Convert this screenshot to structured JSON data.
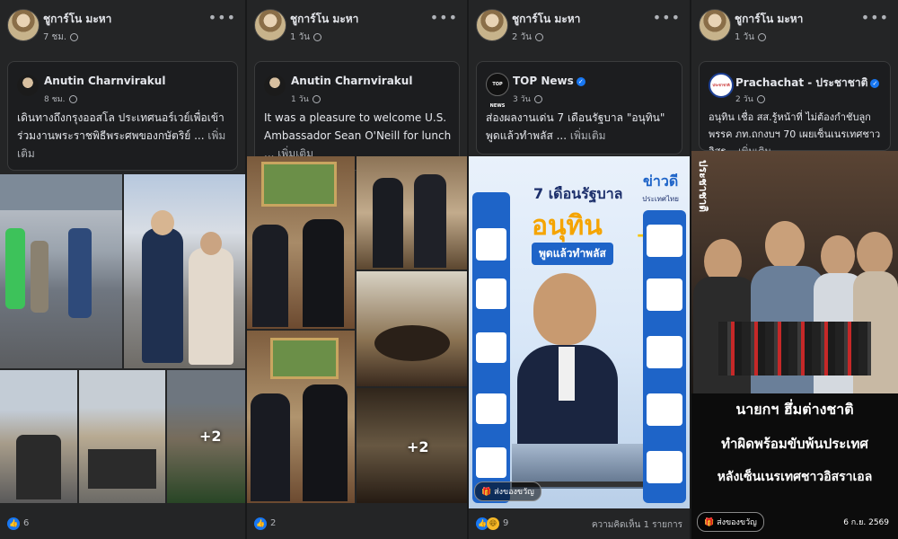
{
  "posts": [
    {
      "poster": "ชูการ์โน มะหา",
      "time": "7 ชม.",
      "card": {
        "name": "Anutin Charnvirakul",
        "time": "8 ชม.",
        "text": "เดินทางถึงกรุงออสโล ประเทศนอร์เวย์เพื่อเข้าร่วมงานพระราชพิธีพระศพของกษัตริย์ ...",
        "see_more": "เพิ่มเติม"
      },
      "photo_more": "+2",
      "reactions": "6"
    },
    {
      "poster": "ชูการ์โน มะหา",
      "time": "1 วัน",
      "card": {
        "name": "Anutin Charnvirakul",
        "time": "1 วัน",
        "text": "It was a pleasure to welcome U.S. Ambassador Sean O'Neill for lunch ...",
        "see_more": "เพิ่มเติม"
      },
      "photo_more": "+2",
      "reactions": "2"
    },
    {
      "poster": "ชูการ์โน มะหา",
      "time": "2 วัน",
      "card": {
        "name": "TOP News",
        "logo": "TOP NEWS",
        "time": "3 วัน",
        "text": "ส่องผลงานเด่น 7 เดือนรัฐบาล \"อนุทิน\" พูดแล้วทำพลัส ...",
        "see_more": "เพิ่มเติม"
      },
      "graphic": {
        "brand_top": "ข่าวดี",
        "brand_bottom": "ประเทศไทย",
        "headline_1": "7 เดือนรัฐบาล",
        "headline_2": "อนุทิน",
        "headline_3": "พูดแล้วทำพลัส",
        "plus_sign": "+"
      },
      "send_gift": "ส่งของขวัญ",
      "reactions": "9",
      "comments": "ความคิดเห็น 1 รายการ"
    },
    {
      "poster": "ชูการ์โน มะหา",
      "time": "1 วัน",
      "card": {
        "name": "Prachachat - ประชาชาติ",
        "logo": "ประชาชาติ",
        "time": "2 วัน",
        "text": "อนุทิน เชื่อ สส.รู้หน้าที่ ไม่ต้องกำชับลูกพรรค ภท.ถกงบฯ 70 เผยเซ็นเนรเทศชาวอิสร...",
        "see_more": "เพิ่มเติม"
      },
      "photo_logo": "ประชาชาติ",
      "headline_lines": [
        "นายกฯ ฮึ่มต่างชาติ",
        "ทำผิดพร้อมขับพ้นประเทศ",
        "หลังเซ็นเนรเทศชาวอิสราเอล"
      ],
      "date": "6 ก.ย. 2569",
      "send_gift": "ส่งของขวัญ"
    }
  ],
  "icons": {
    "like": "like-icon",
    "haha": "haha-icon",
    "globe": "globe-icon",
    "more": "more-options-icon",
    "verified": "verified-badge-icon",
    "gift": "gift-icon"
  },
  "colors": {
    "background": "#18191a",
    "card": "#242526",
    "accent": "#1877f2",
    "graphic_blue": "#1e64c8",
    "graphic_yellow": "#f5c400"
  }
}
